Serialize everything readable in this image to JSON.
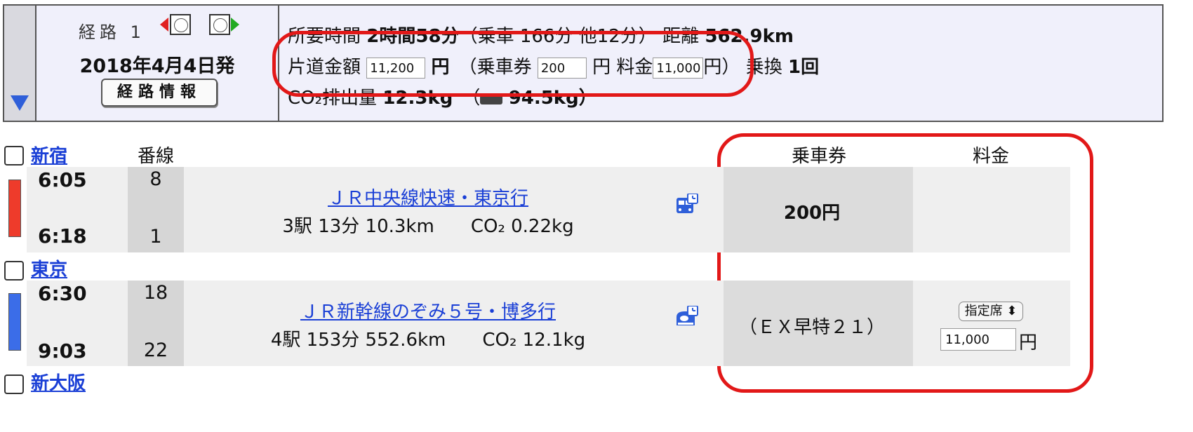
{
  "route": {
    "label": "経路",
    "number": "1",
    "date": "2018年4月4日発",
    "info_button": "経路情報"
  },
  "summary": {
    "duration_label": "所要時間",
    "duration_value": "2時間58分",
    "duration_detail": "（乗車 166分 他12分）",
    "distance_label": "距離",
    "distance_value": "562.9km",
    "oneway_label": "片道金額",
    "oneway_value": "11,200",
    "yen": "円",
    "ticket_label": "（乗車券",
    "ticket_value": "200",
    "fee_label": "料金",
    "fee_value": "11,000",
    "close_paren": "円）",
    "transfer_label": "乗換",
    "transfer_value": "1回",
    "co2_label": "CO₂排出量",
    "co2_value": "12.3kg",
    "co2_car_value": "94.5kg）"
  },
  "columns": {
    "platform": "番線",
    "ticket": "乗車券",
    "fee": "料金"
  },
  "stations": [
    "新宿",
    "東京",
    "新大阪"
  ],
  "segments": [
    {
      "depart": "6:05",
      "arrive": "6:18",
      "platform_from": "8",
      "platform_to": "1",
      "line": "ＪＲ中央線快速・東京行",
      "detail": "3駅 13分 10.3km　　CO₂ 0.22kg",
      "ticket": "200円",
      "color": "#ee3b2b"
    },
    {
      "depart": "6:30",
      "arrive": "9:03",
      "platform_from": "18",
      "platform_to": "22",
      "line": "ＪＲ新幹線のぞみ５号・博多行",
      "detail": "4駅 153分 552.6km　　CO₂ 12.1kg",
      "ticket": "（ＥＸ早特２１）",
      "seat": "指定席",
      "fee": "11,000",
      "color": "#3b6de8"
    }
  ]
}
